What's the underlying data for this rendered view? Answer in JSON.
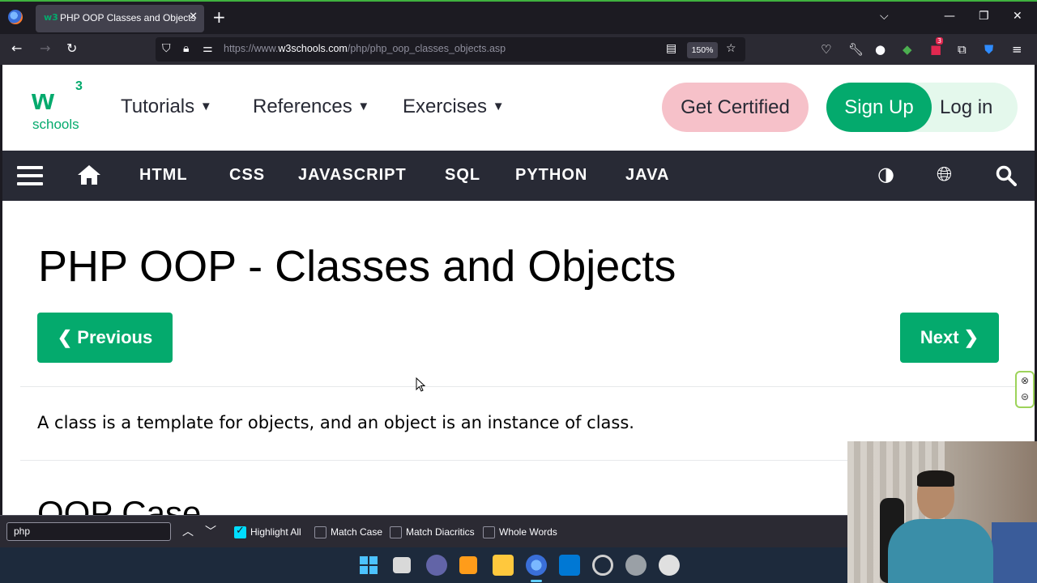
{
  "browser": {
    "tab_title": "PHP OOP Classes and Objects",
    "tab_favicon": "w3",
    "url_prefix": "https://www.",
    "url_host": "w3schools.com",
    "url_path": "/php/php_oop_classes_objects.asp",
    "zoom": "150%",
    "extension_badge": "3",
    "icons": [
      "firefox-logo",
      "back-icon",
      "forward-icon",
      "reload-icon",
      "shield-icon",
      "lock-icon",
      "permissions-icon",
      "reader-view-icon",
      "bookmark-star-icon",
      "pocket-icon",
      "wrench-icon",
      "account-icon",
      "extension-icon",
      "menu-icon"
    ]
  },
  "header": {
    "logo_mark": "w",
    "logo_sup": "3",
    "logo_text": "schools",
    "menu": [
      "Tutorials",
      "References",
      "Exercises"
    ],
    "get_certified": "Get Certified",
    "sign_up": "Sign Up",
    "log_in": "Log in"
  },
  "topnav": {
    "links": [
      "HTML",
      "CSS",
      "JAVASCRIPT",
      "SQL",
      "PYTHON",
      "JAVA"
    ]
  },
  "main": {
    "title": "PHP OOP - Classes and Objects",
    "prev_label": "❮ Previous",
    "next_label": "Next ❯",
    "intro": "A class is a template for objects, and an object is an instance of class.",
    "section_heading": "OOP Case"
  },
  "findbar": {
    "query": "php",
    "options": [
      {
        "label": "Highlight All",
        "checked": true
      },
      {
        "label": "Match Case",
        "checked": false
      },
      {
        "label": "Match Diacritics",
        "checked": false
      },
      {
        "label": "Whole Words",
        "checked": false
      }
    ]
  },
  "colors": {
    "w3_green": "#04aa6d",
    "nav_dark": "#282a35",
    "cert_pink": "#f6c1c9",
    "firefox_chrome": "#2b2a33"
  }
}
